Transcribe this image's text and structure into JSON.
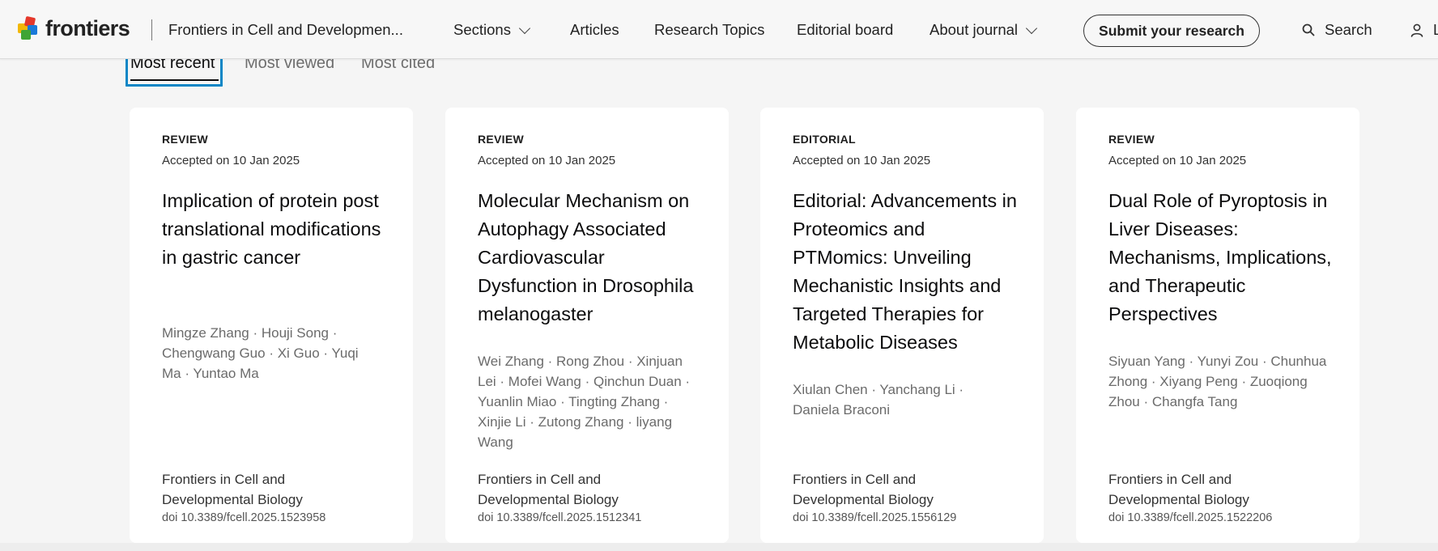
{
  "header": {
    "logo_text": "frontiers",
    "journal_name": "Frontiers in Cell and Developmen...",
    "nav": [
      {
        "label": "Sections",
        "has_dropdown": true
      },
      {
        "label": "Articles",
        "has_dropdown": false
      },
      {
        "label": "Research Topics",
        "has_dropdown": false
      },
      {
        "label": "Editorial board",
        "has_dropdown": false
      },
      {
        "label": "About journal",
        "has_dropdown": true
      }
    ],
    "submit_label": "Submit your research",
    "search_label": "Search",
    "login_label": "L",
    "icons": {
      "search": "search-icon",
      "user": "user-icon",
      "logo": "frontiers-logo-icon"
    }
  },
  "tabs": [
    {
      "label": "Most recent",
      "active": true
    },
    {
      "label": "Most viewed",
      "active": false
    },
    {
      "label": "Most cited",
      "active": false
    }
  ],
  "colors": {
    "focus_outline": "#0a86c6",
    "page_bg": "#f5f5f5",
    "card_bg": "#ffffff"
  },
  "cards": [
    {
      "type": "REVIEW",
      "accepted": "Accepted on 10 Jan 2025",
      "title": "Implication of protein post translational modifications in gastric cancer",
      "authors": "Mingze Zhang · Houji Song · Chengwang Guo · Xi Guo · Yuqi Ma · Yuntao Ma",
      "journal": "Frontiers in Cell and Developmental Biology",
      "doi": "doi 10.3389/fcell.2025.1523958"
    },
    {
      "type": "REVIEW",
      "accepted": "Accepted on 10 Jan 2025",
      "title": "Molecular Mechanism on Autophagy Associated Cardiovascular Dysfunction in Drosophila melanogaster",
      "authors": "Wei Zhang · Rong Zhou · Xinjuan Lei · Mofei Wang · Qinchun Duan · Yuanlin Miao · Tingting Zhang · Xinjie Li · Zutong Zhang · liyang Wang",
      "journal": "Frontiers in Cell and Developmental Biology",
      "doi": "doi 10.3389/fcell.2025.1512341"
    },
    {
      "type": "EDITORIAL",
      "accepted": "Accepted on 10 Jan 2025",
      "title": "Editorial: Advancements in Proteomics and PTMomics: Unveiling Mechanistic Insights and Targeted Therapies for Metabolic Diseases",
      "authors": "Xiulan Chen · Yanchang Li · Daniela Braconi",
      "journal": "Frontiers in Cell and Developmental Biology",
      "doi": "doi 10.3389/fcell.2025.1556129"
    },
    {
      "type": "REVIEW",
      "accepted": "Accepted on 10 Jan 2025",
      "title": "Dual Role of Pyroptosis in Liver Diseases: Mechanisms, Implications, and Therapeutic Perspectives",
      "authors": "Siyuan Yang · Yunyi Zou · Chunhua Zhong · Xiyang Peng · Zuoqiong Zhou · Changfa Tang",
      "journal": "Frontiers in Cell and Developmental Biology",
      "doi": "doi 10.3389/fcell.2025.1522206"
    }
  ]
}
